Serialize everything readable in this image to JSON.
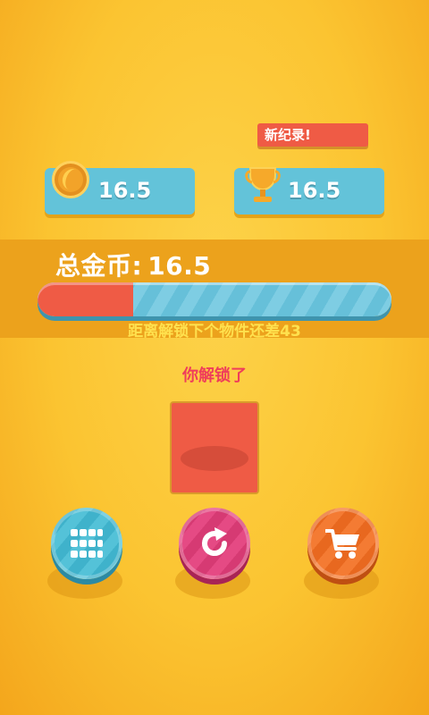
{
  "stats": {
    "current_coins": "16.5",
    "best_score": "16.5",
    "record_badge": "新纪录!"
  },
  "progress": {
    "total_label": "总金币:",
    "total_value": "16.5",
    "fill_fraction": 0.27,
    "unlock_hint": "距离解锁下个物件还差43"
  },
  "result": {
    "unlocked_text": "你解锁了"
  },
  "colors": {
    "background": "#fbc431",
    "band": "#eca21c",
    "card": "#63c3d9",
    "accent_red": "#ef5b45",
    "hint_yellow": "#ffe14e",
    "unlocked_pink": "#ef3d5b"
  },
  "buttons": {
    "grid_icon": "grid-icon",
    "reload_icon": "reload-icon",
    "shop_icon": "cart-icon"
  }
}
